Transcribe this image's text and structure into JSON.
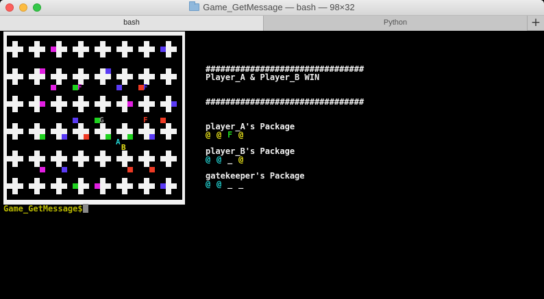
{
  "window": {
    "title": "Game_GetMessage — bash — 98×32",
    "folder_icon": "folder-icon"
  },
  "tabs": [
    {
      "label": "bash",
      "active": true
    },
    {
      "label": "Python",
      "active": false
    }
  ],
  "add_tab_label": "+",
  "maze": {
    "cols": 32,
    "rows": 30,
    "background": "#000000",
    "wall_color": "#f2f2f2",
    "colors": {
      "magenta": "#e21fe2",
      "blue": "#5a3af5",
      "green": "#1fd21f",
      "red": "#ee3a24",
      "gray": "#9a9a9a",
      "cyan": "#22d3d3",
      "yellow": "#e8e21a",
      "white": "#ffffff"
    },
    "labels": [
      {
        "text": "F",
        "col": 13,
        "row": 9,
        "color": "magenta"
      },
      {
        "text": "F",
        "col": 25,
        "row": 9,
        "color": "blue"
      },
      {
        "text": "G",
        "col": 17,
        "row": 15,
        "color": "gray"
      },
      {
        "text": "F",
        "col": 25,
        "row": 15,
        "color": "red"
      },
      {
        "text": "A",
        "col": 20,
        "row": 19,
        "color": "cyan"
      },
      {
        "text": "B",
        "col": 21,
        "row": 20,
        "color": "yellow"
      }
    ]
  },
  "output": {
    "hash_line": "################################",
    "win_message": "Player_A & Player_B WIN",
    "packages": [
      {
        "label": "player_A's Package",
        "items": [
          {
            "glyph": "@",
            "color": "#e8e21a"
          },
          {
            "glyph": "@",
            "color": "#e8e21a"
          },
          {
            "glyph": "F",
            "color": "#1fd21f"
          },
          {
            "glyph": "@",
            "color": "#e8e21a"
          }
        ]
      },
      {
        "label": "player_B's Package",
        "items": [
          {
            "glyph": "@",
            "color": "#22d3d3"
          },
          {
            "glyph": "@",
            "color": "#22d3d3"
          },
          {
            "glyph": "_",
            "color": "#f0f0f0"
          },
          {
            "glyph": "@",
            "color": "#e8e21a"
          }
        ]
      },
      {
        "label": "gatekeeper's Package",
        "items": [
          {
            "glyph": "@",
            "color": "#22d3d3"
          },
          {
            "glyph": "@",
            "color": "#22d3d3"
          },
          {
            "glyph": "_",
            "color": "#f0f0f0"
          },
          {
            "glyph": "_",
            "color": "#f0f0f0"
          }
        ]
      }
    ]
  },
  "prompt": {
    "text": "Game_GetMessage$",
    "color": "#b9b900"
  }
}
